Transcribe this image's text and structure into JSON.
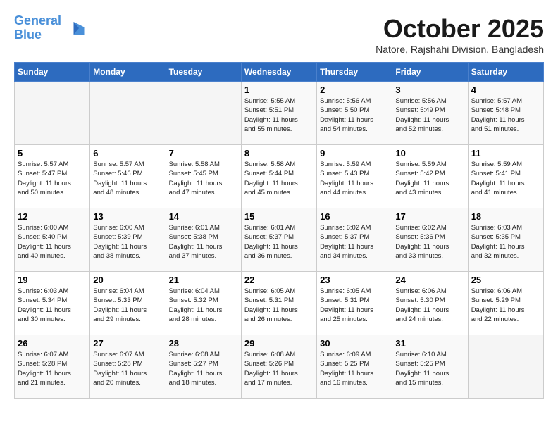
{
  "header": {
    "logo_line1": "General",
    "logo_line2": "Blue",
    "month": "October 2025",
    "location": "Natore, Rajshahi Division, Bangladesh"
  },
  "weekdays": [
    "Sunday",
    "Monday",
    "Tuesday",
    "Wednesday",
    "Thursday",
    "Friday",
    "Saturday"
  ],
  "weeks": [
    [
      {
        "day": "",
        "info": ""
      },
      {
        "day": "",
        "info": ""
      },
      {
        "day": "",
        "info": ""
      },
      {
        "day": "1",
        "info": "Sunrise: 5:55 AM\nSunset: 5:51 PM\nDaylight: 11 hours\nand 55 minutes."
      },
      {
        "day": "2",
        "info": "Sunrise: 5:56 AM\nSunset: 5:50 PM\nDaylight: 11 hours\nand 54 minutes."
      },
      {
        "day": "3",
        "info": "Sunrise: 5:56 AM\nSunset: 5:49 PM\nDaylight: 11 hours\nand 52 minutes."
      },
      {
        "day": "4",
        "info": "Sunrise: 5:57 AM\nSunset: 5:48 PM\nDaylight: 11 hours\nand 51 minutes."
      }
    ],
    [
      {
        "day": "5",
        "info": "Sunrise: 5:57 AM\nSunset: 5:47 PM\nDaylight: 11 hours\nand 50 minutes."
      },
      {
        "day": "6",
        "info": "Sunrise: 5:57 AM\nSunset: 5:46 PM\nDaylight: 11 hours\nand 48 minutes."
      },
      {
        "day": "7",
        "info": "Sunrise: 5:58 AM\nSunset: 5:45 PM\nDaylight: 11 hours\nand 47 minutes."
      },
      {
        "day": "8",
        "info": "Sunrise: 5:58 AM\nSunset: 5:44 PM\nDaylight: 11 hours\nand 45 minutes."
      },
      {
        "day": "9",
        "info": "Sunrise: 5:59 AM\nSunset: 5:43 PM\nDaylight: 11 hours\nand 44 minutes."
      },
      {
        "day": "10",
        "info": "Sunrise: 5:59 AM\nSunset: 5:42 PM\nDaylight: 11 hours\nand 43 minutes."
      },
      {
        "day": "11",
        "info": "Sunrise: 5:59 AM\nSunset: 5:41 PM\nDaylight: 11 hours\nand 41 minutes."
      }
    ],
    [
      {
        "day": "12",
        "info": "Sunrise: 6:00 AM\nSunset: 5:40 PM\nDaylight: 11 hours\nand 40 minutes."
      },
      {
        "day": "13",
        "info": "Sunrise: 6:00 AM\nSunset: 5:39 PM\nDaylight: 11 hours\nand 38 minutes."
      },
      {
        "day": "14",
        "info": "Sunrise: 6:01 AM\nSunset: 5:38 PM\nDaylight: 11 hours\nand 37 minutes."
      },
      {
        "day": "15",
        "info": "Sunrise: 6:01 AM\nSunset: 5:37 PM\nDaylight: 11 hours\nand 36 minutes."
      },
      {
        "day": "16",
        "info": "Sunrise: 6:02 AM\nSunset: 5:37 PM\nDaylight: 11 hours\nand 34 minutes."
      },
      {
        "day": "17",
        "info": "Sunrise: 6:02 AM\nSunset: 5:36 PM\nDaylight: 11 hours\nand 33 minutes."
      },
      {
        "day": "18",
        "info": "Sunrise: 6:03 AM\nSunset: 5:35 PM\nDaylight: 11 hours\nand 32 minutes."
      }
    ],
    [
      {
        "day": "19",
        "info": "Sunrise: 6:03 AM\nSunset: 5:34 PM\nDaylight: 11 hours\nand 30 minutes."
      },
      {
        "day": "20",
        "info": "Sunrise: 6:04 AM\nSunset: 5:33 PM\nDaylight: 11 hours\nand 29 minutes."
      },
      {
        "day": "21",
        "info": "Sunrise: 6:04 AM\nSunset: 5:32 PM\nDaylight: 11 hours\nand 28 minutes."
      },
      {
        "day": "22",
        "info": "Sunrise: 6:05 AM\nSunset: 5:31 PM\nDaylight: 11 hours\nand 26 minutes."
      },
      {
        "day": "23",
        "info": "Sunrise: 6:05 AM\nSunset: 5:31 PM\nDaylight: 11 hours\nand 25 minutes."
      },
      {
        "day": "24",
        "info": "Sunrise: 6:06 AM\nSunset: 5:30 PM\nDaylight: 11 hours\nand 24 minutes."
      },
      {
        "day": "25",
        "info": "Sunrise: 6:06 AM\nSunset: 5:29 PM\nDaylight: 11 hours\nand 22 minutes."
      }
    ],
    [
      {
        "day": "26",
        "info": "Sunrise: 6:07 AM\nSunset: 5:28 PM\nDaylight: 11 hours\nand 21 minutes."
      },
      {
        "day": "27",
        "info": "Sunrise: 6:07 AM\nSunset: 5:28 PM\nDaylight: 11 hours\nand 20 minutes."
      },
      {
        "day": "28",
        "info": "Sunrise: 6:08 AM\nSunset: 5:27 PM\nDaylight: 11 hours\nand 18 minutes."
      },
      {
        "day": "29",
        "info": "Sunrise: 6:08 AM\nSunset: 5:26 PM\nDaylight: 11 hours\nand 17 minutes."
      },
      {
        "day": "30",
        "info": "Sunrise: 6:09 AM\nSunset: 5:25 PM\nDaylight: 11 hours\nand 16 minutes."
      },
      {
        "day": "31",
        "info": "Sunrise: 6:10 AM\nSunset: 5:25 PM\nDaylight: 11 hours\nand 15 minutes."
      },
      {
        "day": "",
        "info": ""
      }
    ]
  ]
}
